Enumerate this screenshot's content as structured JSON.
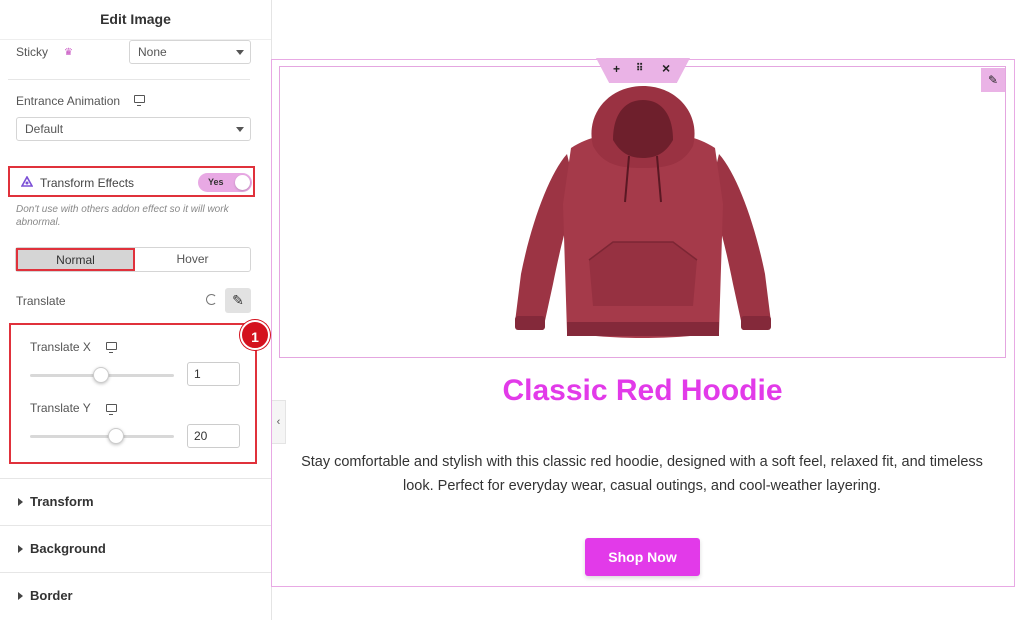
{
  "panel": {
    "title": "Edit Image",
    "sticky": {
      "label": "Sticky",
      "value": "None"
    },
    "entrance": {
      "label": "Entrance Animation",
      "value": "Default"
    },
    "transform_effects": {
      "label": "Transform Effects",
      "toggle_text": "Yes",
      "note": "Don't use with others addon effect so it will work abnormal."
    },
    "tabs": [
      "Normal",
      "Hover"
    ],
    "translate": {
      "label": "Translate",
      "x": {
        "label": "Translate X",
        "value": "1",
        "level": 0.49
      },
      "y": {
        "label": "Translate Y",
        "value": "20",
        "level": 0.6
      }
    },
    "callout_number": "1",
    "sections": [
      "Transform",
      "Background",
      "Border"
    ]
  },
  "canvas": {
    "title": "Classic Red Hoodie",
    "description": "Stay comfortable and stylish with this classic red hoodie, designed with a soft feel, relaxed fit, and timeless look. Perfect for everyday wear, casual outings, and cool-weather layering.",
    "button": "Shop Now",
    "handle_icons": [
      "+",
      "⠿",
      "×"
    ]
  },
  "colors": {
    "accent": "#e23ae9",
    "highlight": "#e0313b",
    "hoodie": "#a53a4a"
  }
}
